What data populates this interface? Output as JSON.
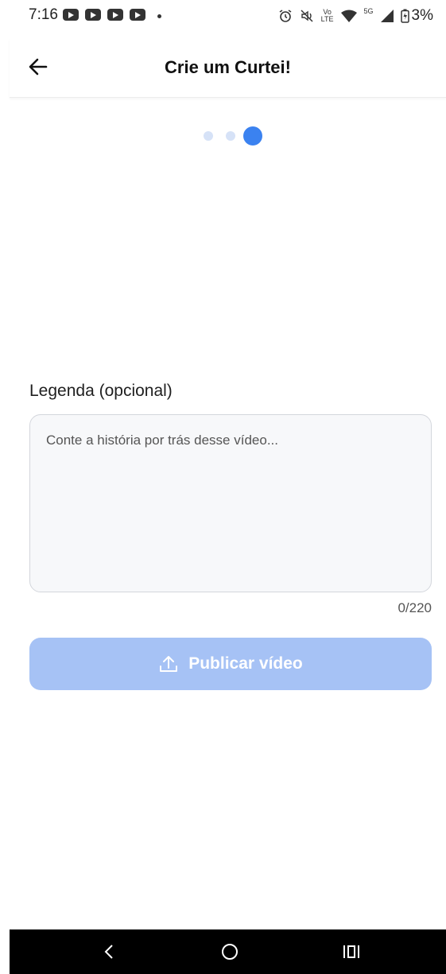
{
  "status_bar": {
    "time": "7:16",
    "battery": "3%",
    "volte_top": "Vo",
    "volte_bottom": "LTE",
    "network": "5G",
    "icons": [
      "youtube-icon",
      "youtube-icon",
      "youtube-icon",
      "youtube-icon",
      "dot-icon",
      "alarm-icon",
      "mute-icon",
      "volte-icon",
      "wifi-icon",
      "signal-icon",
      "battery-icon"
    ]
  },
  "header": {
    "title": "Crie um Curtei!",
    "back_icon": "arrow-left-icon"
  },
  "steps": {
    "total": 3,
    "current": 3
  },
  "caption": {
    "label": "Legenda (opcional)",
    "placeholder": "Conte a história por trás desse vídeo...",
    "value": "",
    "counter": "0/220"
  },
  "publish": {
    "label": "Publicar vídeo",
    "icon": "upload-icon"
  },
  "nav": {
    "icons": [
      "back-nav-icon",
      "home-nav-icon",
      "recents-nav-icon"
    ]
  },
  "colors": {
    "accent": "#3b82f0",
    "button_disabled": "#a6c2f5",
    "step_inactive": "#d6e2f7",
    "field_bg": "#f7f8fa"
  }
}
